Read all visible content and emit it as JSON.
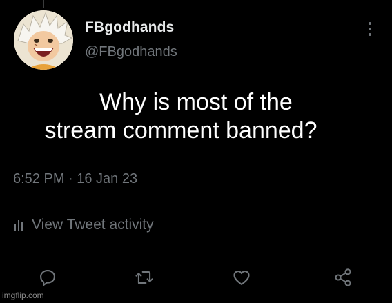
{
  "author": {
    "display_name": "FBgodhands",
    "handle": "@FBgodhands",
    "avatar_icon": "anime-character-avatar"
  },
  "tweet": {
    "text_line_1": "Why is most of the",
    "text_line_2": "stream comment banned?",
    "timestamp": "6:52 PM · 16 Jan 23"
  },
  "activity": {
    "label": "View Tweet activity",
    "icon": "bar-chart-icon"
  },
  "actions": {
    "reply_icon": "reply-icon",
    "retweet_icon": "retweet-icon",
    "like_icon": "heart-icon",
    "share_icon": "share-icon"
  },
  "colors": {
    "background": "#000000",
    "primary_text": "#e7e9ea",
    "secondary_text": "#71767b",
    "divider": "#2f3336"
  },
  "watermark": "imgflip.com"
}
